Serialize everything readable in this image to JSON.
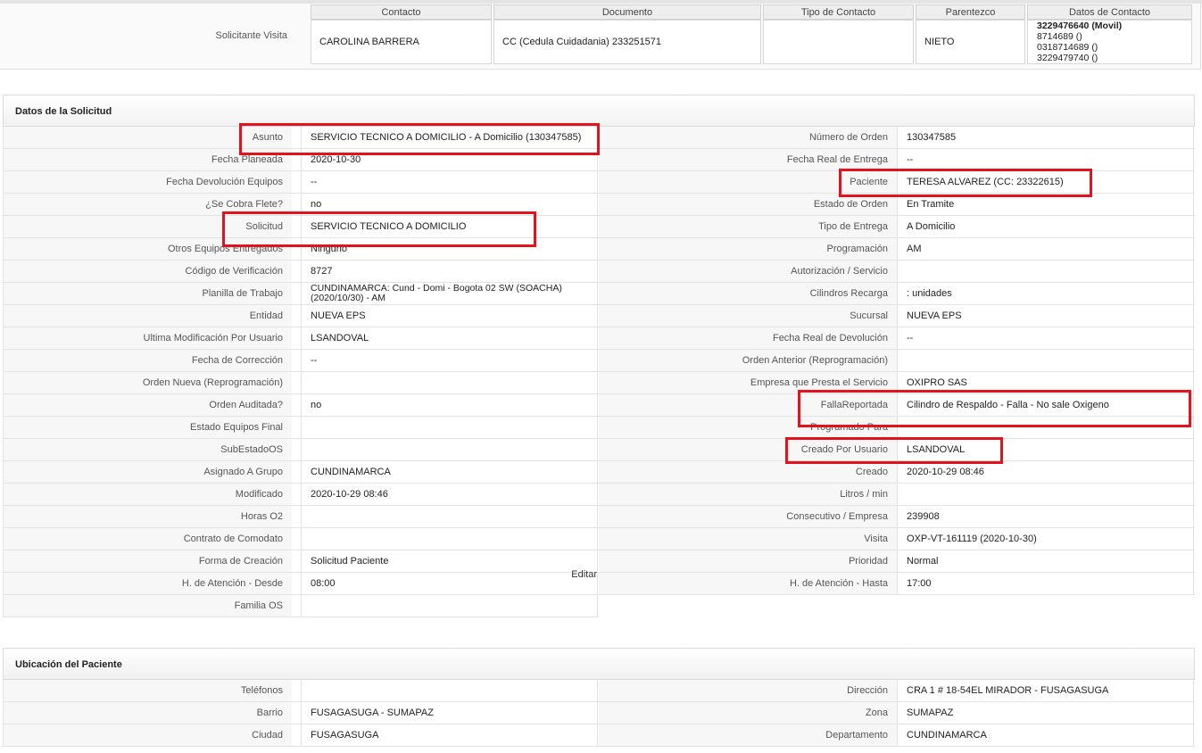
{
  "solicitante": {
    "label": "Solicitante Visita",
    "headers": [
      "Contacto",
      "Documento",
      "Tipo de Contacto",
      "Parentezco",
      "Datos de Contacto"
    ],
    "row": {
      "contacto": "CAROLINA BARRERA",
      "documento": "CC (Cedula Cuidadania) 233251571",
      "tipo": "",
      "parentezco": "NIETO",
      "datos": [
        "3229476640 (Movil)",
        "8714689 ()",
        "0318714689 ()",
        "3229479740 ()"
      ]
    }
  },
  "solicitud": {
    "title": "Datos de la Solicitud",
    "edit_label": "Editar",
    "left": [
      {
        "label": "Asunto",
        "value": "SERVICIO TECNICO A DOMICILIO - A Domicilio (130347585)"
      },
      {
        "label": "Fecha Planeada",
        "value": "2020-10-30"
      },
      {
        "label": "Fecha Devolución Equipos",
        "value": "--"
      },
      {
        "label": "¿Se Cobra Flete?",
        "value": "no"
      },
      {
        "label": "Solicitud",
        "value": "SERVICIO TECNICO A DOMICILIO"
      },
      {
        "label": "Otros Equipos Entregados",
        "value": "Ninguno"
      },
      {
        "label": "Código de Verificación",
        "value": "8727"
      },
      {
        "label": "Planilla de Trabajo",
        "value": "CUNDINAMARCA: Cund - Domi - Bogota 02 SW (SOACHA) (2020/10/30) - AM"
      },
      {
        "label": "Entidad",
        "value": "NUEVA EPS"
      },
      {
        "label": "Ultima Modificación Por Usuario",
        "value": "LSANDOVAL"
      },
      {
        "label": "Fecha de Corrección",
        "value": "--"
      },
      {
        "label": "Orden Nueva (Reprogramación)",
        "value": ""
      },
      {
        "label": "Orden Auditada?",
        "value": "no"
      },
      {
        "label": "Estado Equipos Final",
        "value": ""
      },
      {
        "label": "SubEstadoOS",
        "value": ""
      },
      {
        "label": "Asignado A Grupo",
        "value": "CUNDINAMARCA"
      },
      {
        "label": "Modificado",
        "value": "2020-10-29 08:46"
      },
      {
        "label": "Horas O2",
        "value": ""
      },
      {
        "label": "Contrato de Comodato",
        "value": ""
      },
      {
        "label": "Forma de Creación",
        "value": "Solicitud Paciente"
      },
      {
        "label": "H. de Atención - Desde",
        "value": "08:00"
      },
      {
        "label": "Familia OS",
        "value": ""
      }
    ],
    "right": [
      {
        "label": "Número de Orden",
        "value": "130347585"
      },
      {
        "label": "Fecha Real de Entrega",
        "value": "--"
      },
      {
        "label": "Paciente",
        "value": "TERESA ALVAREZ (CC: 23322615)"
      },
      {
        "label": "Estado de Orden",
        "value": "En Tramite"
      },
      {
        "label": "Tipo de Entrega",
        "value": "A Domicilio"
      },
      {
        "label": "Programación",
        "value": "AM"
      },
      {
        "label": "Autorización / Servicio",
        "value": ""
      },
      {
        "label": "Cilindros Recarga",
        "value": ": unidades"
      },
      {
        "label": "Sucursal",
        "value": "NUEVA EPS"
      },
      {
        "label": "Fecha Real de Devolución",
        "value": "--"
      },
      {
        "label": "Orden Anterior (Reprogramación)",
        "value": ""
      },
      {
        "label": "Empresa que Presta el Servicio",
        "value": "OXIPRO SAS"
      },
      {
        "label": "FallaReportada",
        "value": "Cilindro de Respaldo - Falla - No sale Oxigeno"
      },
      {
        "label": "Programado Para",
        "value": ""
      },
      {
        "label": "Creado Por Usuario",
        "value": "LSANDOVAL"
      },
      {
        "label": "Creado",
        "value": "2020-10-29 08:46"
      },
      {
        "label": "Litros / min",
        "value": ""
      },
      {
        "label": "Consecutivo / Empresa",
        "value": "239908"
      },
      {
        "label": "Visita",
        "value": "OXP-VT-161119 (2020-10-30)"
      },
      {
        "label": "Prioridad",
        "value": "Normal"
      },
      {
        "label": "H. de Atención - Hasta",
        "value": "17:00"
      }
    ]
  },
  "ubicacion": {
    "title": "Ubicación del Paciente",
    "left": [
      {
        "label": "Teléfonos",
        "value": ""
      },
      {
        "label": "Barrio",
        "value": "FUSAGASUGA - SUMAPAZ"
      },
      {
        "label": "Ciudad",
        "value": "FUSAGASUGA"
      }
    ],
    "right": [
      {
        "label": "Dirección",
        "value": "CRA 1 # 18-54EL MIRADOR - FUSAGASUGA"
      },
      {
        "label": "Zona",
        "value": "SUMAPAZ"
      },
      {
        "label": "Departamento",
        "value": "CUNDINAMARCA"
      }
    ]
  },
  "highlight_color": "#e3121c"
}
